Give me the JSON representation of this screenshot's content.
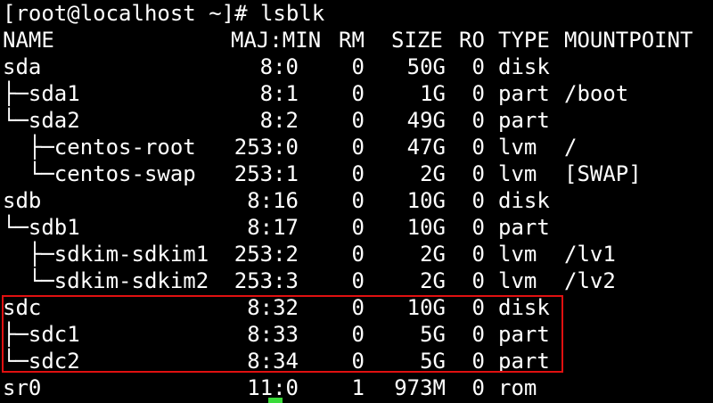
{
  "terminal": {
    "prompt": "[root@localhost ~]# lsblk",
    "headers": {
      "name": "NAME",
      "majmin": "MAJ:MIN",
      "rm": "RM",
      "size": "SIZE",
      "ro": "RO",
      "type": "TYPE",
      "mountpoint": "MOUNTPOINT"
    },
    "rows": [
      {
        "name": "sda",
        "majmin": "8:0",
        "rm": "0",
        "size": "50G",
        "ro": "0",
        "type": "disk",
        "mountpoint": ""
      },
      {
        "name": "├─sda1",
        "majmin": "8:1",
        "rm": "0",
        "size": "1G",
        "ro": "0",
        "type": "part",
        "mountpoint": "/boot"
      },
      {
        "name": "└─sda2",
        "majmin": "8:2",
        "rm": "0",
        "size": "49G",
        "ro": "0",
        "type": "part",
        "mountpoint": ""
      },
      {
        "name": "  ├─centos-root",
        "majmin": "253:0",
        "rm": "0",
        "size": "47G",
        "ro": "0",
        "type": "lvm",
        "mountpoint": "/"
      },
      {
        "name": "  └─centos-swap",
        "majmin": "253:1",
        "rm": "0",
        "size": "2G",
        "ro": "0",
        "type": "lvm",
        "mountpoint": "[SWAP]"
      },
      {
        "name": "sdb",
        "majmin": "8:16",
        "rm": "0",
        "size": "10G",
        "ro": "0",
        "type": "disk",
        "mountpoint": ""
      },
      {
        "name": "└─sdb1",
        "majmin": "8:17",
        "rm": "0",
        "size": "10G",
        "ro": "0",
        "type": "part",
        "mountpoint": ""
      },
      {
        "name": "  ├─sdkim-sdkim1",
        "majmin": "253:2",
        "rm": "0",
        "size": "2G",
        "ro": "0",
        "type": "lvm",
        "mountpoint": "/lv1"
      },
      {
        "name": "  └─sdkim-sdkim2",
        "majmin": "253:3",
        "rm": "0",
        "size": "2G",
        "ro": "0",
        "type": "lvm",
        "mountpoint": "/lv2"
      },
      {
        "name": "sdc",
        "majmin": "8:32",
        "rm": "0",
        "size": "10G",
        "ro": "0",
        "type": "disk",
        "mountpoint": ""
      },
      {
        "name": "├─sdc1",
        "majmin": "8:33",
        "rm": "0",
        "size": "5G",
        "ro": "0",
        "type": "part",
        "mountpoint": ""
      },
      {
        "name": "└─sdc2",
        "majmin": "8:34",
        "rm": "0",
        "size": "5G",
        "ro": "0",
        "type": "part",
        "mountpoint": ""
      },
      {
        "name": "sr0",
        "majmin": "11:0",
        "rm": "1",
        "size": "973M",
        "ro": "0",
        "type": "rom",
        "mountpoint": ""
      }
    ]
  },
  "colors": {
    "background": "#000000",
    "text": "#ffffff",
    "highlight_border": "#e01010",
    "cursor": "#3adb3a"
  }
}
